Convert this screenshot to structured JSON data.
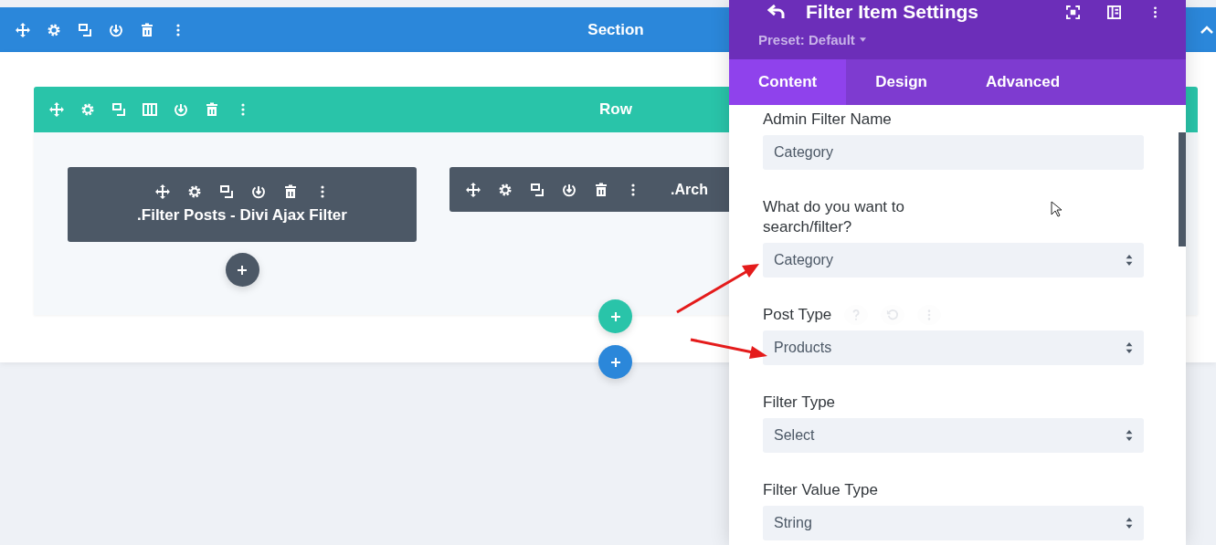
{
  "section": {
    "title": "Section"
  },
  "row": {
    "title": "Row"
  },
  "modules": [
    {
      "title": ".Filter Posts - Divi Ajax Filter",
      "kind": "full"
    },
    {
      "title": ".Arch",
      "kind": "compact"
    }
  ],
  "panel": {
    "title": "Filter Item Settings",
    "preset": "Preset: Default",
    "tabs": [
      {
        "label": "Content",
        "selected": true
      },
      {
        "label": "Design",
        "selected": false
      },
      {
        "label": "Advanced",
        "selected": false
      }
    ],
    "fields": [
      {
        "label": "Admin Filter Name",
        "value": "Category",
        "kind": "text",
        "tools": false
      },
      {
        "label": "What do you want to search/filter?",
        "value": "Category",
        "kind": "select",
        "tools": false
      },
      {
        "label": "Post Type",
        "value": "Products",
        "kind": "select",
        "tools": true
      },
      {
        "label": "Filter Type",
        "value": "Select",
        "kind": "select",
        "tools": false
      },
      {
        "label": "Filter Value Type",
        "value": "String",
        "kind": "select",
        "tools": false
      }
    ]
  }
}
